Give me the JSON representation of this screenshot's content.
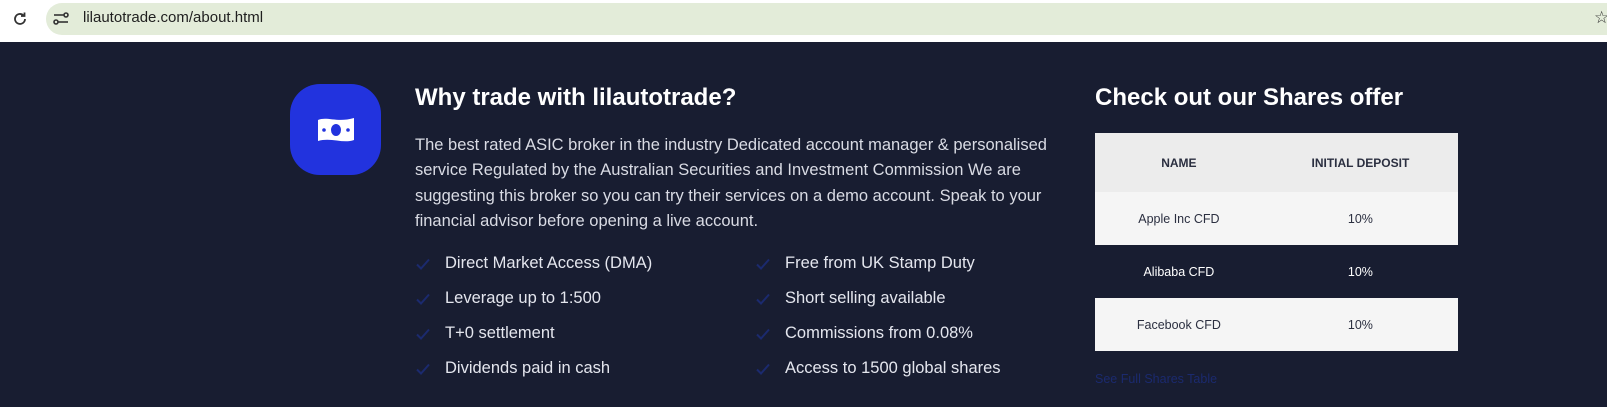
{
  "browser": {
    "url": "lilautotrade.com/about.html"
  },
  "why": {
    "title": "Why trade with lilautotrade?",
    "description": "The best rated ASIC broker in the industry Dedicated account manager & personalised service Regulated by the Australian Securities and Investment Commission We are suggesting this broker so you can try their services on a demo account. Speak to your financial advisor before opening a live account.",
    "features_left": [
      "Direct Market Access (DMA)",
      "Leverage up to 1:500",
      "T+0 settlement",
      "Dividends paid in cash"
    ],
    "features_right": [
      "Free from UK Stamp Duty",
      "Short selling available",
      "Commissions from 0.08%",
      "Access to 1500 global shares"
    ]
  },
  "shares": {
    "title": "Check out our Shares offer",
    "headers": [
      "NAME",
      "INITIAL DEPOSIT"
    ],
    "rows": [
      [
        "Apple Inc CFD",
        "10%"
      ],
      [
        "Alibaba CFD",
        "10%"
      ],
      [
        "Facebook CFD",
        "10%"
      ]
    ],
    "link_text": "See Full Shares Table"
  },
  "colors": {
    "page_bg": "#181d31",
    "accent_blue": "#2233de",
    "check_color": "#1b2a6e"
  },
  "icons": {
    "reload": "reload-icon",
    "site_info": "site-info-icon",
    "bookmark": "star-icon",
    "money": "banknote-icon",
    "check": "check-icon"
  }
}
